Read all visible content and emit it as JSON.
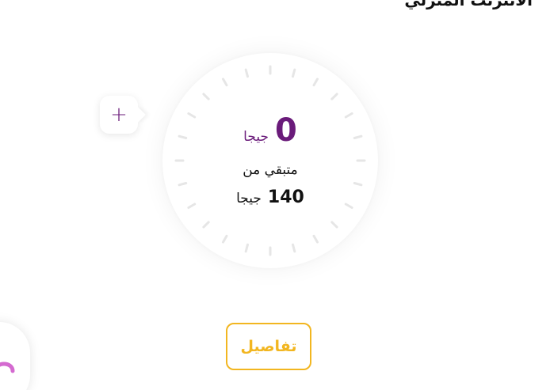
{
  "header": {
    "title": "الانترنت المنزلي"
  },
  "gauge": {
    "remaining_value": "0",
    "remaining_unit": "جيجا",
    "remaining_label": "متبقي من",
    "total_value": "140",
    "total_unit": "جيجا"
  },
  "actions": {
    "add_icon": "plus-icon",
    "details_label": "تفاصيل",
    "chat_icon": "headset-icon"
  },
  "colors": {
    "accent_purple": "#6a1b7a",
    "accent_yellow": "#f2b620",
    "chat_pink": "#d46ad0"
  }
}
